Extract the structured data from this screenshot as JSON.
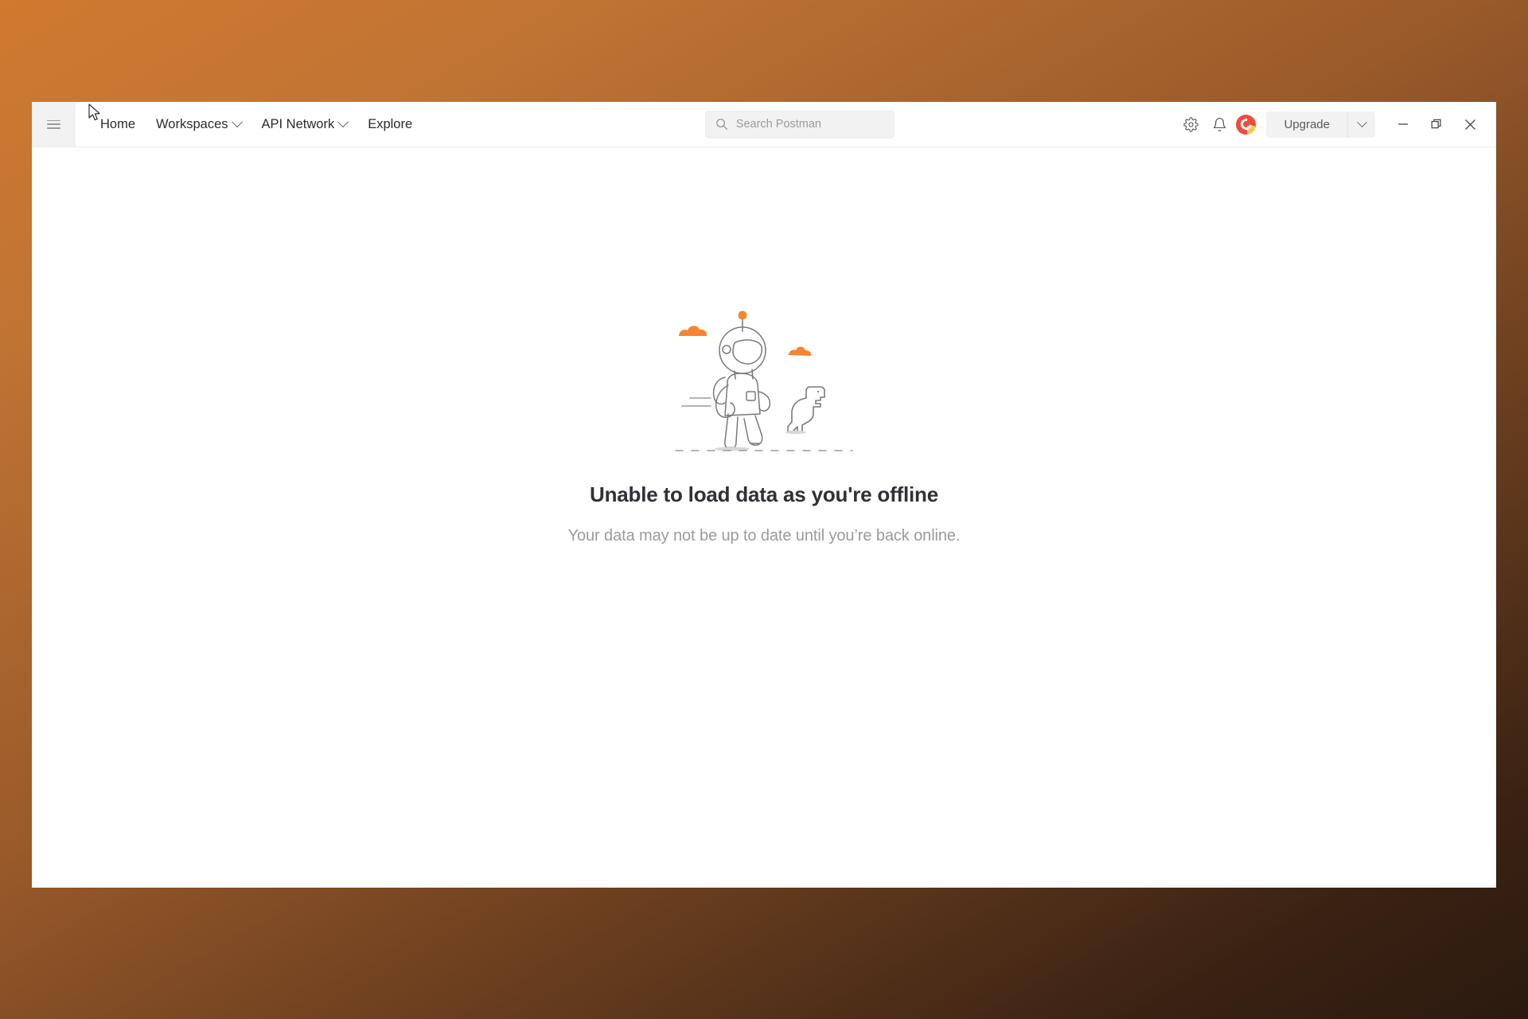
{
  "window": {
    "sidebar_toggle": "hamburger-menu",
    "nav_items": [
      {
        "label": "Home",
        "has_caret": false
      },
      {
        "label": "Workspaces",
        "has_caret": true
      },
      {
        "label": "API Network",
        "has_caret": true
      },
      {
        "label": "Explore",
        "has_caret": false
      }
    ],
    "search": {
      "placeholder": "Search Postman",
      "icon": "search-icon"
    },
    "actions": {
      "settings_icon": "gear-icon",
      "notifications_icon": "bell-icon",
      "avatar": "user-avatar",
      "upgrade_label": "Upgrade",
      "upgrade_caret": "chevron-down-icon"
    },
    "window_controls": {
      "minimize": "minimize-icon",
      "restore": "restore-icon",
      "close": "close-icon"
    }
  },
  "main": {
    "illustration": "astronaut-offline-illustration",
    "title": "Unable to load data as you're offline",
    "subtitle": "Your data may not be up to date until you’re back online."
  },
  "colors": {
    "desktop_top": "#d0792f",
    "desktop_bottom": "#2b1a0f",
    "accent_orange": "#f58634",
    "avatar_red": "#f04c3e",
    "avatar_yellow": "#f9c84a",
    "title_text": "#2f3136",
    "muted_text": "#9b9b9b",
    "panel_gray": "#f2f2f2"
  }
}
